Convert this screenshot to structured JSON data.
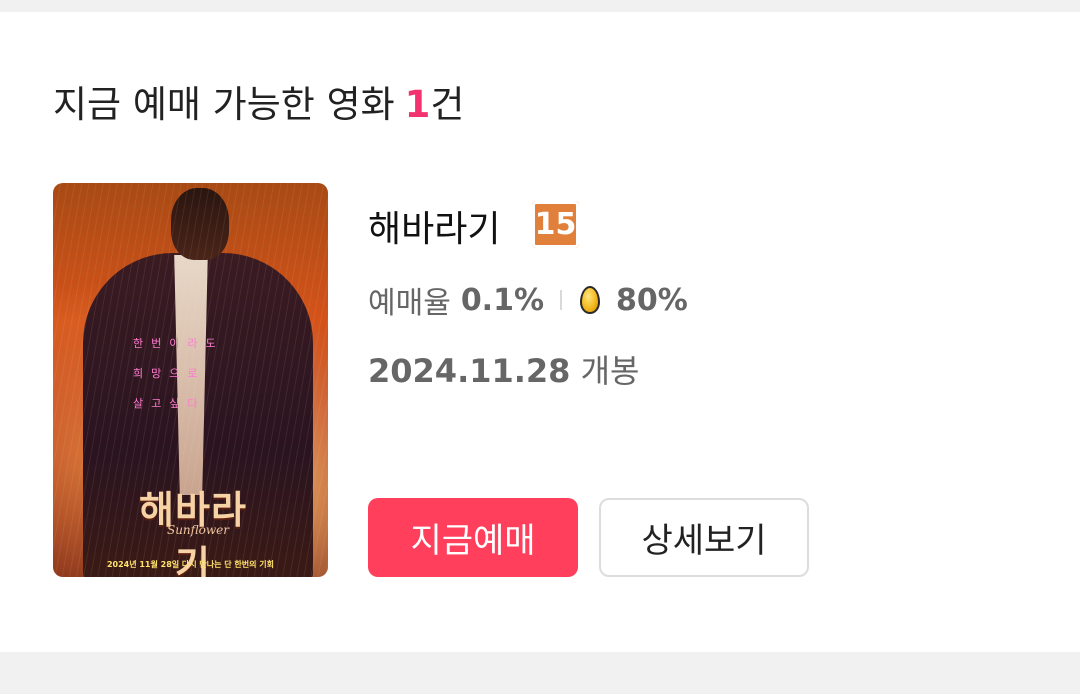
{
  "section": {
    "heading_prefix": "지금 예매 가능한 영화",
    "count": "1",
    "count_suffix": "건"
  },
  "movie": {
    "title": "해바라기",
    "age_rating": "15",
    "booking_rate_label": "예매율",
    "booking_rate_value": "0.1%",
    "golden_egg_icon": "golden-egg-icon",
    "golden_egg_score": "80%",
    "release_date": "2024.11.28",
    "release_suffix": "개봉",
    "poster": {
      "title": "해바라기",
      "subtitle": "Sunflower",
      "tagline_1": "한번이라도",
      "tagline_2": "희망으로",
      "tagline_3": "살고싶다",
      "release_line": "2024년 11월 28일 다시 만나는 단 한번의 기회"
    }
  },
  "actions": {
    "book_label": "지금예매",
    "detail_label": "상세보기"
  },
  "colors": {
    "accent_pink": "#f2336f",
    "book_button": "#ff3f5b",
    "age_badge": "#e1803a"
  }
}
